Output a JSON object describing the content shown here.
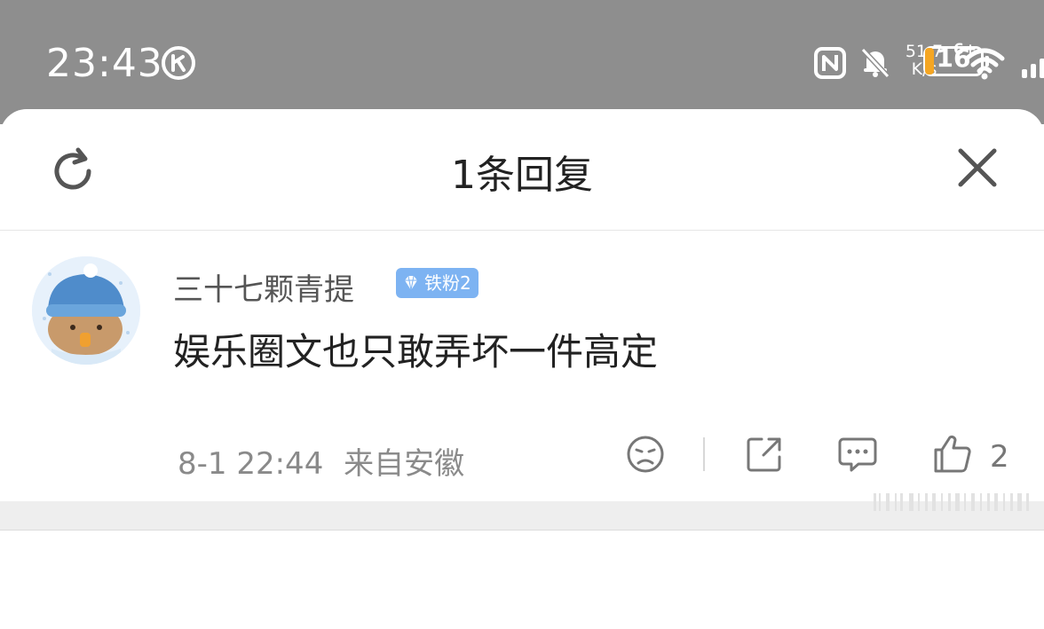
{
  "status_bar": {
    "time": "23:43",
    "net_speed_value": "51.7",
    "net_speed_unit": "K/s",
    "signal_type": "6+",
    "battery_level": "16",
    "battery_color": "#f5a623",
    "icons": [
      "nfc-icon",
      "mute-bell-icon",
      "wifi-icon",
      "signal-bars-icon",
      "battery-icon"
    ]
  },
  "sheet": {
    "title": "1条回复"
  },
  "comment": {
    "username": "三十七颗青提",
    "badge": "铁粉2",
    "text": "娱乐圈文也只敢弄坏一件高定",
    "timestamp": "8-1 22:44",
    "location": "来自安徽",
    "like_count": "2"
  },
  "colors": {
    "status_bar_bg": "#8e8e8e",
    "badge_bg": "#7db3f2",
    "section_gap": "#eeeeee"
  }
}
